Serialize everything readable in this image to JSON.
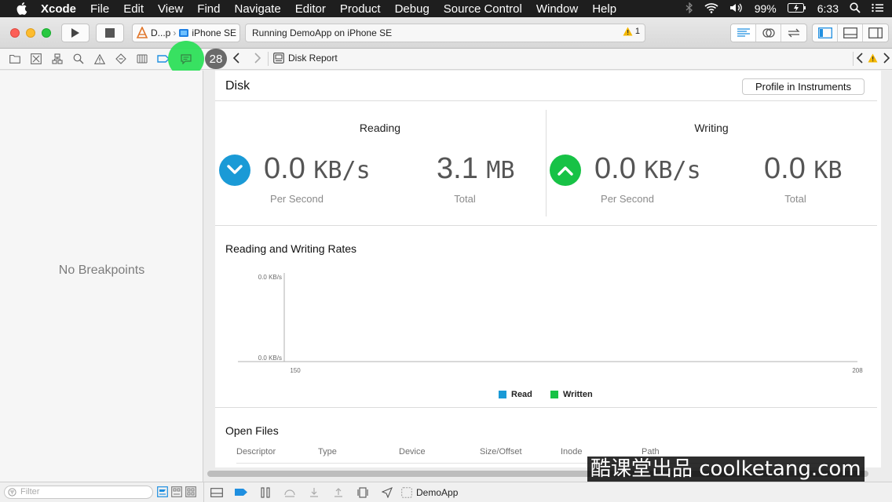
{
  "menubar": {
    "app": "Xcode",
    "menus": [
      "File",
      "Edit",
      "View",
      "Find",
      "Navigate",
      "Editor",
      "Product",
      "Debug",
      "Source Control",
      "Window",
      "Help"
    ],
    "battery": "99%",
    "time": "6:33"
  },
  "toolbar": {
    "scheme_target": "D...p",
    "device": "iPhone SE",
    "activity_text": "Running DemoApp on iPhone SE",
    "warning_count": "1"
  },
  "navigator": {
    "badge": "28"
  },
  "jumpbar": {
    "title": "Disk Report"
  },
  "sidebar": {
    "empty_text": "No Breakpoints",
    "filter_placeholder": "Filter"
  },
  "report": {
    "title": "Disk",
    "profile_button": "Profile in Instruments",
    "reading": {
      "label": "Reading",
      "rate_value": "0.0",
      "rate_unit": "KB/s",
      "rate_caption": "Per Second",
      "total_value": "3.1",
      "total_unit": "MB",
      "total_caption": "Total"
    },
    "writing": {
      "label": "Writing",
      "rate_value": "0.0",
      "rate_unit": "KB/s",
      "rate_caption": "Per Second",
      "total_value": "0.0",
      "total_unit": "KB",
      "total_caption": "Total"
    },
    "rates_title": "Reading and Writing Rates",
    "open_files_title": "Open Files",
    "open_files_columns": [
      "Descriptor",
      "Type",
      "Device",
      "Size/Offset",
      "Inode",
      "Path"
    ]
  },
  "chart_data": {
    "type": "line",
    "title": "Reading and Writing Rates",
    "y_tick_labels": [
      "0.0 KB/s",
      "0.0 KB/s"
    ],
    "x_tick_labels": [
      "150",
      "208"
    ],
    "xlim": [
      150,
      208
    ],
    "ylim": [
      0,
      0
    ],
    "series": [
      {
        "name": "Read",
        "values": []
      },
      {
        "name": "Written",
        "values": []
      }
    ],
    "colors": {
      "Read": "#1a9ad6",
      "Written": "#17c246"
    },
    "legend": "bottom-center",
    "grid": false
  },
  "debugbar": {
    "process": "DemoApp"
  },
  "colors": {
    "accent_blue": "#1f8fe0",
    "read_circle": "#1a9ad6",
    "write_circle": "#17c246",
    "cursor_highlight": "#2ee05a"
  },
  "watermark": "酷课堂出品 coolketang.com"
}
